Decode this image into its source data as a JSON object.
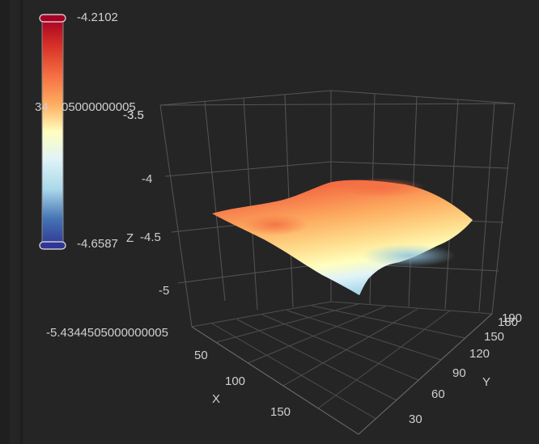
{
  "chart_data": {
    "type": "surface3d",
    "colorscale": "RdYlBu (reversed)",
    "colorbar": {
      "max_label": "-4.2102",
      "min_label": "-4.6587",
      "overlap_labels": [
        "-3.5",
        "34",
        "05000000005"
      ]
    },
    "axes": {
      "x": {
        "title": "X",
        "ticks": [
          "50",
          "100",
          "150"
        ]
      },
      "y": {
        "title": "Y",
        "ticks": [
          "30",
          "60",
          "90",
          "120",
          "150",
          "180",
          "190"
        ]
      },
      "z": {
        "title": "Z",
        "ticks": [
          "-5.4344505000000005",
          "-5",
          "-4.5",
          "-4",
          "-3.5"
        ]
      }
    },
    "surface": {
      "x_range": [
        1,
        200
      ],
      "y_range": [
        1,
        190
      ],
      "z_min": -4.6587,
      "z_max": -4.2102
    }
  },
  "colors": {
    "background": "#252526",
    "grid": "#5a5a5a",
    "scale_top": "#a50026",
    "scale_mid": "#ffffbf",
    "scale_bottom": "#313695"
  }
}
